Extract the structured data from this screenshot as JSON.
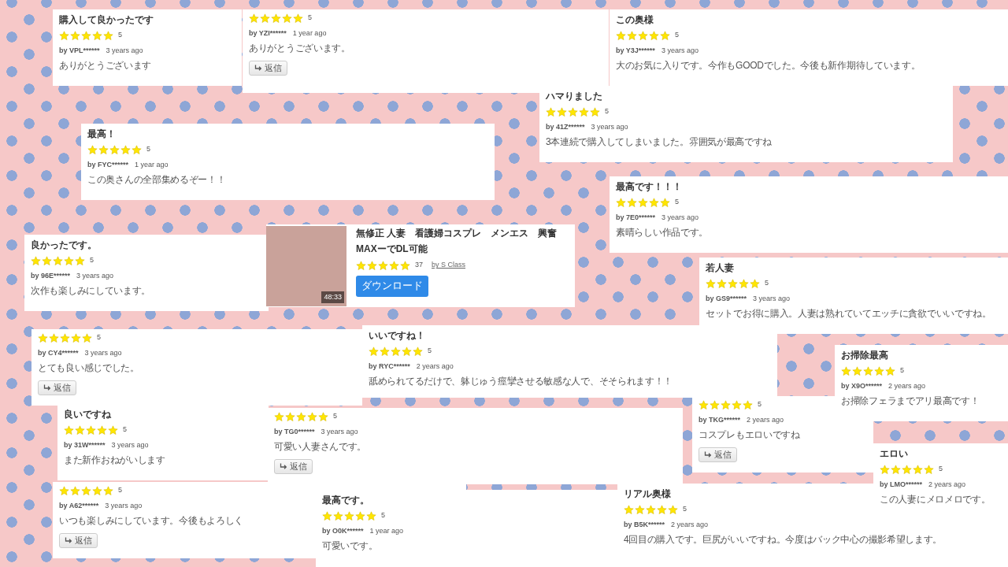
{
  "reviews": [
    {
      "title": "購入して良かったです",
      "stars": 5,
      "rating": "5",
      "user": "by VPL******",
      "ago": "3 years ago",
      "comment": "ありがとうございます"
    },
    {
      "stars": 5,
      "rating": "5",
      "user": "by YZI******",
      "ago": "1 year ago",
      "comment": "ありがとうございます。",
      "reply": "返信"
    },
    {
      "title": "この奥様",
      "stars": 5,
      "rating": "5",
      "user": "by Y3J******",
      "ago": "3 years ago",
      "comment": "大のお気に入りです。今作もGOODでした。今後も新作期待しています。"
    },
    {
      "title": "ハマりました",
      "stars": 5,
      "rating": "5",
      "user": "by 41Z******",
      "ago": "3 years ago",
      "comment": "3本連続で購入してしまいました。雰囲気が最高ですね"
    },
    {
      "title": "最高！",
      "stars": 5,
      "rating": "5",
      "user": "by FYC******",
      "ago": "1 year ago",
      "comment": "この奥さんの全部集めるぞー！！"
    },
    {
      "title": "最高です！！！",
      "stars": 5,
      "rating": "5",
      "user": "by 7E0******",
      "ago": "3 years ago",
      "comment": "素晴らしい作品です。"
    },
    {
      "title": "良かったです。",
      "stars": 5,
      "rating": "5",
      "user": "by 96E******",
      "ago": "3 years ago",
      "comment": "次作も楽しみにしています。"
    },
    {
      "title": "若人妻",
      "stars": 5,
      "rating": "5",
      "user": "by GS9******",
      "ago": "3 years ago",
      "comment": "セットでお得に購入。人妻は熟れていてエッチに貪欲でいいですね。"
    },
    {
      "stars": 5,
      "rating": "5",
      "user": "by CY4******",
      "ago": "3 years ago",
      "comment": "とても良い感じでした。",
      "reply": "返信"
    },
    {
      "title": "いいですね！",
      "stars": 5,
      "rating": "5",
      "user": "by RYC******",
      "ago": "2 years ago",
      "comment": "舐められてるだけで、躰じゅう痙攣させる敏感な人で、そそられます！！"
    },
    {
      "title": "お掃除最高",
      "stars": 5,
      "rating": "5",
      "user": "by X9O******",
      "ago": "2 years ago",
      "comment": "お掃除フェラまでアリ最高です！"
    },
    {
      "stars": 5,
      "rating": "5",
      "user": "by TKG******",
      "ago": "2 years ago",
      "comment": "コスプレもエロいですね",
      "reply": "返信"
    },
    {
      "title": "良いですね",
      "stars": 5,
      "rating": "5",
      "user": "by 31W******",
      "ago": "3 years ago",
      "comment": "また新作おねがいします"
    },
    {
      "stars": 5,
      "rating": "5",
      "user": "by TG0******",
      "ago": "3 years ago",
      "comment": "可愛い人妻さんです。",
      "reply": "返信"
    },
    {
      "stars": 5,
      "rating": "5",
      "user": "by A62******",
      "ago": "3 years ago",
      "comment": "いつも楽しみにしています。今後もよろしく",
      "reply": "返信"
    },
    {
      "title": "最高です。",
      "stars": 5,
      "rating": "5",
      "user": "by O0K******",
      "ago": "1 year ago",
      "comment": "可愛いです。"
    },
    {
      "title": "リアル奥様",
      "stars": 5,
      "rating": "5",
      "user": "by B5K******",
      "ago": "2 years ago",
      "comment": "4回目の購入です。巨尻がいいですね。今度はバック中心の撮影希望します。"
    },
    {
      "title": "エロい",
      "stars": 5,
      "rating": "5",
      "user": "by LMO******",
      "ago": "2 years ago",
      "comment": "この人妻にメロメロです。"
    }
  ],
  "product": {
    "duration": "48:33",
    "title": "無修正 人妻　看護婦コスプレ　メンエス　興奮MAXーでDL可能",
    "stars": 5,
    "rating": "37",
    "seller": "by S Class",
    "download": "ダウンロード"
  }
}
